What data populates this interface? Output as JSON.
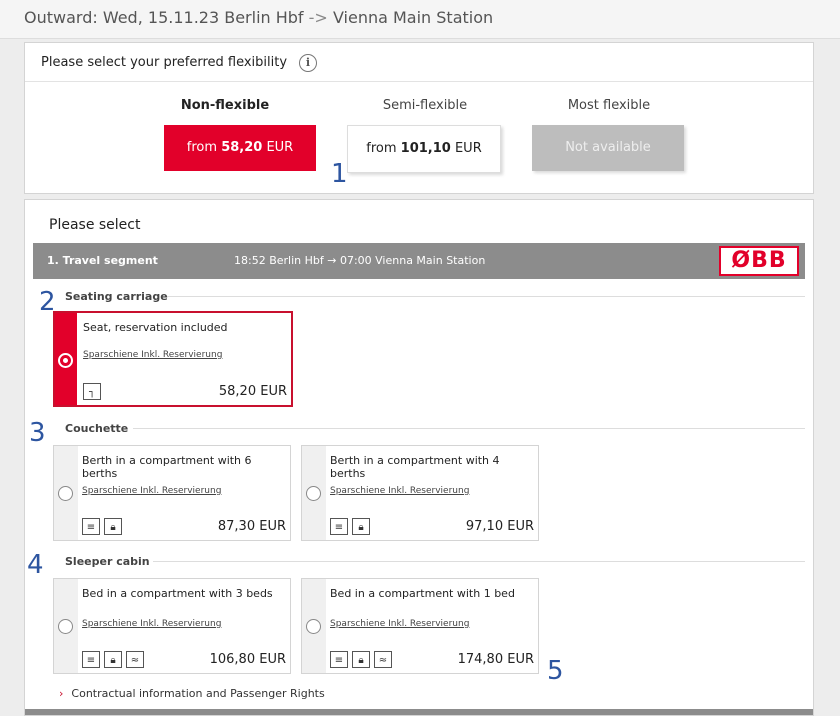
{
  "outward": "Outward: Wed, 15.11.23 Berlin Hbf",
  "outward_arrow": "->",
  "outward_dest": "Vienna Main Station",
  "flex": {
    "header": "Please select your preferred flexibility",
    "info_icon": "i",
    "options": [
      {
        "label": "Non-flexible",
        "price_prefix": "from",
        "price": "58,20",
        "currency": "EUR"
      },
      {
        "label": "Semi-flexible",
        "price_prefix": "from",
        "price": "101,10",
        "currency": "EUR"
      },
      {
        "label": "Most flexible",
        "status": "Not available"
      }
    ]
  },
  "select": {
    "heading": "Please select",
    "segment": {
      "label": "1. Travel segment",
      "route": "18:52 Berlin Hbf → 07:00 Vienna Main Station",
      "brand": "ØBB"
    },
    "sections": [
      {
        "name": "Seating carriage"
      },
      {
        "name": "Couchette"
      },
      {
        "name": "Sleeper cabin"
      }
    ],
    "offers": [
      {
        "title": "Seat, reservation included",
        "tariff": "Sparschiene Inkl. Reservierung",
        "price": "58,20 EUR"
      },
      {
        "title": "Berth in a compartment with 6 berths",
        "tariff": "Sparschiene Inkl. Reservierung",
        "price": "87,30 EUR"
      },
      {
        "title": "Berth in a compartment with 4 berths",
        "tariff": "Sparschiene Inkl. Reservierung",
        "price": "97,10 EUR"
      },
      {
        "title": "Bed in a compartment with 3 beds",
        "tariff": "Sparschiene Inkl. Reservierung",
        "price": "106,80 EUR"
      },
      {
        "title": "Bed in a compartment with 1 bed",
        "tariff": "Sparschiene Inkl. Reservierung",
        "price": "174,80 EUR"
      }
    ],
    "contract": "Contractual information and Passenger Rights"
  },
  "annotations": [
    "1",
    "2",
    "3",
    "4",
    "5"
  ],
  "colors": {
    "accent": "#e2002a",
    "segment_bar": "#8c8c8c",
    "annotation": "#2d55a0"
  },
  "icon_names": [
    "seat-icon",
    "couchette-icon",
    "lock-icon",
    "shower-icon"
  ]
}
